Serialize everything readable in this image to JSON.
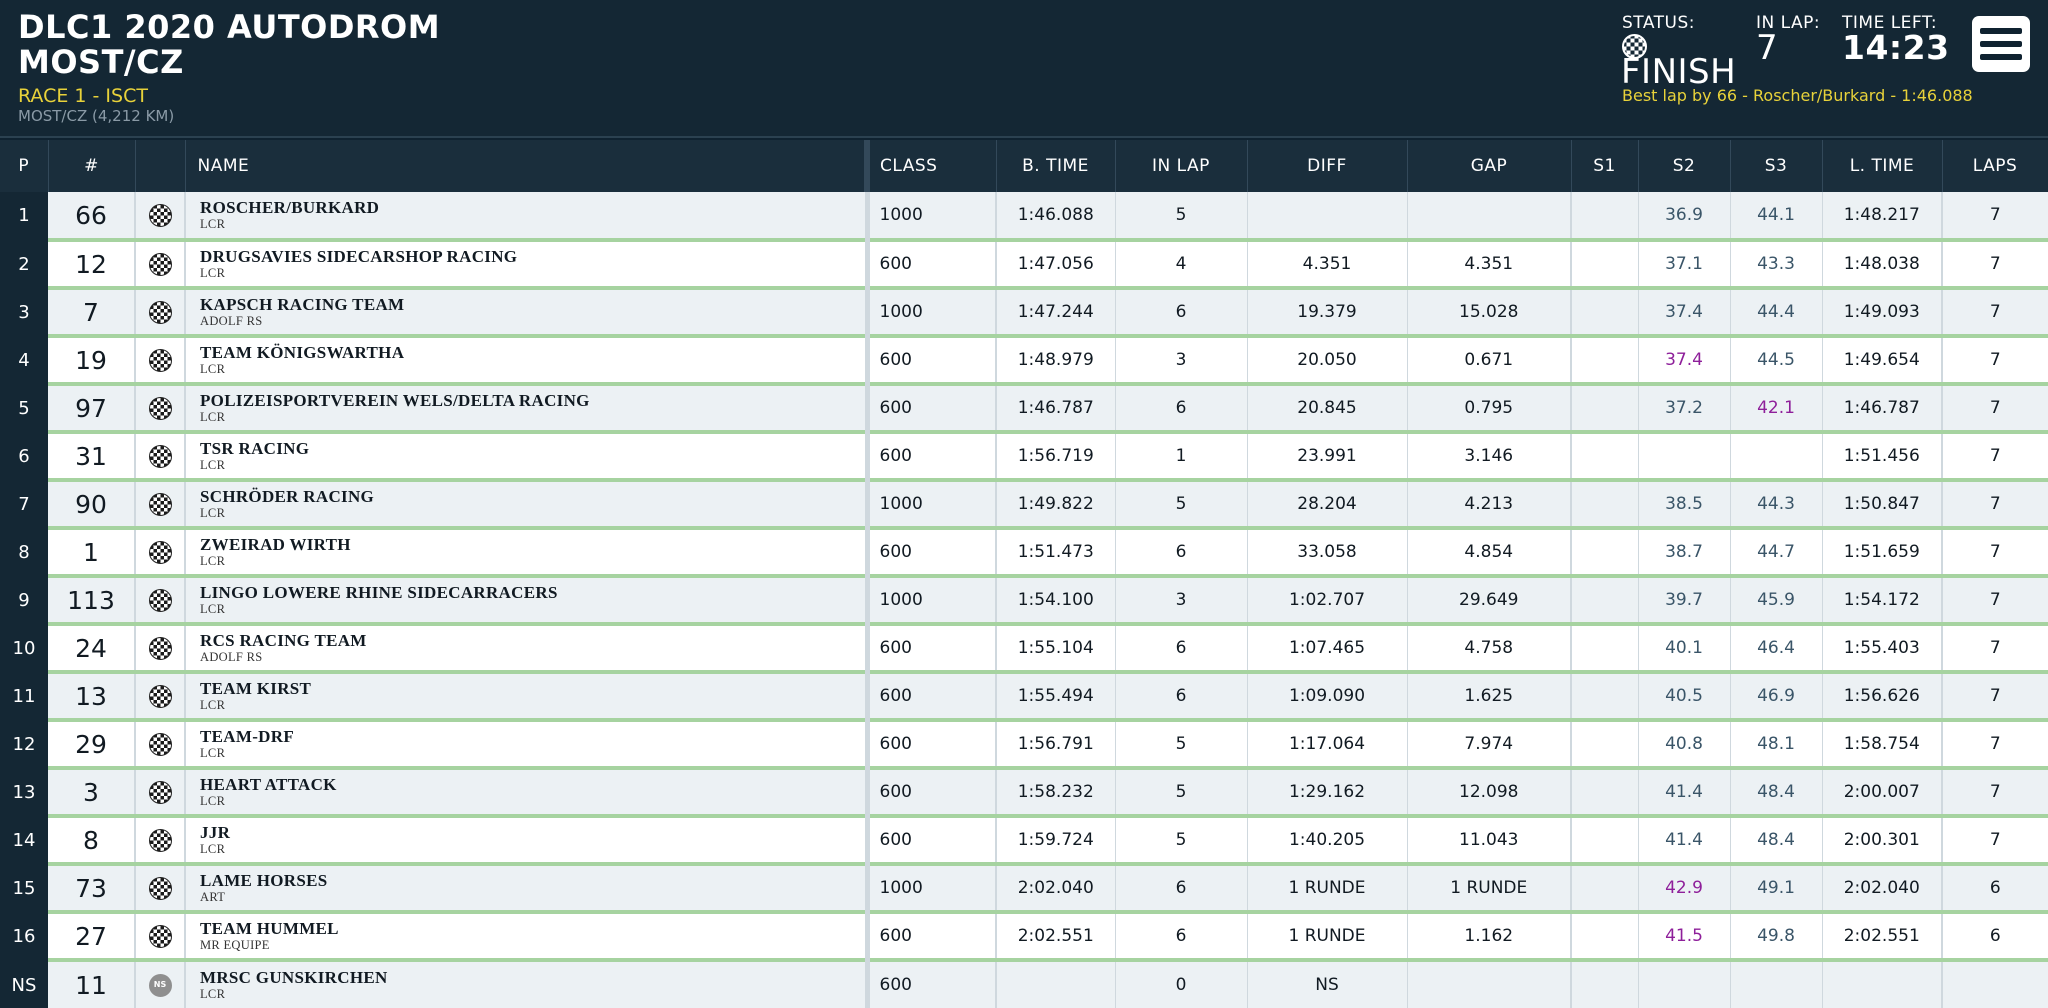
{
  "header": {
    "event_title": "DLC1 2020 AUTODROM MOST/CZ",
    "session": "RACE 1 - ISCT",
    "track": "MOST/CZ (4,212 KM)",
    "status_label": "STATUS:",
    "status_value": "FINISH",
    "status_icon": "checkered-flag-icon",
    "lap_label": "IN LAP:",
    "lap_value": "7",
    "time_label": "TIME LEFT:",
    "time_value": "14:23",
    "best_lap": "Best lap by 66 - Roscher/Burkard - 1:46.088",
    "menu_icon": "hamburger-menu-icon"
  },
  "columns": [
    "P",
    "#",
    "",
    "NAME",
    "CLASS",
    "B. TIME",
    "IN LAP",
    "DIFF",
    "GAP",
    "S1",
    "S2",
    "S3",
    "L. TIME",
    "LAPS"
  ],
  "colors": {
    "accent_green": "#a6d3a0",
    "purple_sector": "#8e1f9a",
    "header_bg": "#142734",
    "highlight": "#e8d23a"
  },
  "rows": [
    {
      "pos": "1",
      "num": "66",
      "flag": "checkered",
      "team": "ROSCHER/BURKARD",
      "bike": "LCR",
      "cls": "1000",
      "btime": "1:46.088",
      "inlap": "5",
      "diff": "",
      "gap": "",
      "s1": "",
      "s2": "36.9",
      "s2p": false,
      "s3": "44.1",
      "s3p": false,
      "ltime": "1:48.217",
      "laps": "7"
    },
    {
      "pos": "2",
      "num": "12",
      "flag": "checkered",
      "team": "DRUGSAVIES SIDECARSHOP RACING",
      "bike": "LCR",
      "cls": "600",
      "btime": "1:47.056",
      "inlap": "4",
      "diff": "4.351",
      "gap": "4.351",
      "s1": "",
      "s2": "37.1",
      "s2p": false,
      "s3": "43.3",
      "s3p": false,
      "ltime": "1:48.038",
      "laps": "7"
    },
    {
      "pos": "3",
      "num": "7",
      "flag": "checkered",
      "team": "KAPSCH RACING TEAM",
      "bike": "ADOLF RS",
      "cls": "1000",
      "btime": "1:47.244",
      "inlap": "6",
      "diff": "19.379",
      "gap": "15.028",
      "s1": "",
      "s2": "37.4",
      "s2p": false,
      "s3": "44.4",
      "s3p": false,
      "ltime": "1:49.093",
      "laps": "7"
    },
    {
      "pos": "4",
      "num": "19",
      "flag": "checkered",
      "team": "TEAM KÖNIGSWARTHA",
      "bike": "LCR",
      "cls": "600",
      "btime": "1:48.979",
      "inlap": "3",
      "diff": "20.050",
      "gap": "0.671",
      "s1": "",
      "s2": "37.4",
      "s2p": true,
      "s3": "44.5",
      "s3p": false,
      "ltime": "1:49.654",
      "laps": "7"
    },
    {
      "pos": "5",
      "num": "97",
      "flag": "checkered",
      "team": "POLIZEISPORTVEREIN WELS/DELTA RACING",
      "bike": "LCR",
      "cls": "600",
      "btime": "1:46.787",
      "inlap": "6",
      "diff": "20.845",
      "gap": "0.795",
      "s1": "",
      "s2": "37.2",
      "s2p": false,
      "s3": "42.1",
      "s3p": true,
      "ltime": "1:46.787",
      "laps": "7"
    },
    {
      "pos": "6",
      "num": "31",
      "flag": "checkered",
      "team": "TSR RACING",
      "bike": "LCR",
      "cls": "600",
      "btime": "1:56.719",
      "inlap": "1",
      "diff": "23.991",
      "gap": "3.146",
      "s1": "",
      "s2": "",
      "s2p": false,
      "s3": "",
      "s3p": false,
      "ltime": "1:51.456",
      "laps": "7"
    },
    {
      "pos": "7",
      "num": "90",
      "flag": "checkered",
      "team": "SCHRÖDER RACING",
      "bike": "LCR",
      "cls": "1000",
      "btime": "1:49.822",
      "inlap": "5",
      "diff": "28.204",
      "gap": "4.213",
      "s1": "",
      "s2": "38.5",
      "s2p": false,
      "s3": "44.3",
      "s3p": false,
      "ltime": "1:50.847",
      "laps": "7"
    },
    {
      "pos": "8",
      "num": "1",
      "flag": "checkered",
      "team": "ZWEIRAD WIRTH",
      "bike": "LCR",
      "cls": "600",
      "btime": "1:51.473",
      "inlap": "6",
      "diff": "33.058",
      "gap": "4.854",
      "s1": "",
      "s2": "38.7",
      "s2p": false,
      "s3": "44.7",
      "s3p": false,
      "ltime": "1:51.659",
      "laps": "7"
    },
    {
      "pos": "9",
      "num": "113",
      "flag": "checkered",
      "team": "LINGO LOWERE RHINE SIDECARRACERS",
      "bike": "LCR",
      "cls": "1000",
      "btime": "1:54.100",
      "inlap": "3",
      "diff": "1:02.707",
      "gap": "29.649",
      "s1": "",
      "s2": "39.7",
      "s2p": false,
      "s3": "45.9",
      "s3p": false,
      "ltime": "1:54.172",
      "laps": "7"
    },
    {
      "pos": "10",
      "num": "24",
      "flag": "checkered",
      "team": "RCS RACING TEAM",
      "bike": "ADOLF RS",
      "cls": "600",
      "btime": "1:55.104",
      "inlap": "6",
      "diff": "1:07.465",
      "gap": "4.758",
      "s1": "",
      "s2": "40.1",
      "s2p": false,
      "s3": "46.4",
      "s3p": false,
      "ltime": "1:55.403",
      "laps": "7"
    },
    {
      "pos": "11",
      "num": "13",
      "flag": "checkered",
      "team": "TEAM KIRST",
      "bike": "LCR",
      "cls": "600",
      "btime": "1:55.494",
      "inlap": "6",
      "diff": "1:09.090",
      "gap": "1.625",
      "s1": "",
      "s2": "40.5",
      "s2p": false,
      "s3": "46.9",
      "s3p": false,
      "ltime": "1:56.626",
      "laps": "7"
    },
    {
      "pos": "12",
      "num": "29",
      "flag": "checkered",
      "team": "TEAM-DRF",
      "bike": "LCR",
      "cls": "600",
      "btime": "1:56.791",
      "inlap": "5",
      "diff": "1:17.064",
      "gap": "7.974",
      "s1": "",
      "s2": "40.8",
      "s2p": false,
      "s3": "48.1",
      "s3p": false,
      "ltime": "1:58.754",
      "laps": "7"
    },
    {
      "pos": "13",
      "num": "3",
      "flag": "checkered",
      "team": "HEART ATTACK",
      "bike": "LCR",
      "cls": "600",
      "btime": "1:58.232",
      "inlap": "5",
      "diff": "1:29.162",
      "gap": "12.098",
      "s1": "",
      "s2": "41.4",
      "s2p": false,
      "s3": "48.4",
      "s3p": false,
      "ltime": "2:00.007",
      "laps": "7"
    },
    {
      "pos": "14",
      "num": "8",
      "flag": "checkered",
      "team": "JJR",
      "bike": "LCR",
      "cls": "600",
      "btime": "1:59.724",
      "inlap": "5",
      "diff": "1:40.205",
      "gap": "11.043",
      "s1": "",
      "s2": "41.4",
      "s2p": false,
      "s3": "48.4",
      "s3p": false,
      "ltime": "2:00.301",
      "laps": "7"
    },
    {
      "pos": "15",
      "num": "73",
      "flag": "checkered",
      "team": "LAME HORSES",
      "bike": "ART",
      "cls": "1000",
      "btime": "2:02.040",
      "inlap": "6",
      "diff": "1 RUNDE",
      "gap": "1 RUNDE",
      "s1": "",
      "s2": "42.9",
      "s2p": true,
      "s3": "49.1",
      "s3p": false,
      "ltime": "2:02.040",
      "laps": "6"
    },
    {
      "pos": "16",
      "num": "27",
      "flag": "checkered",
      "team": "TEAM HUMMEL",
      "bike": "MR EQUIPE",
      "cls": "600",
      "btime": "2:02.551",
      "inlap": "6",
      "diff": "1 RUNDE",
      "gap": "1.162",
      "s1": "",
      "s2": "41.5",
      "s2p": true,
      "s3": "49.8",
      "s3p": false,
      "ltime": "2:02.551",
      "laps": "6"
    },
    {
      "pos": "NS",
      "num": "11",
      "flag": "ns",
      "flag_text": "NS",
      "team": "MRSC GUNSKIRCHEN",
      "bike": "LCR",
      "cls": "600",
      "btime": "",
      "inlap": "0",
      "diff": "NS",
      "gap": "",
      "s1": "",
      "s2": "",
      "s2p": false,
      "s3": "",
      "s3p": false,
      "ltime": "",
      "laps": ""
    }
  ]
}
